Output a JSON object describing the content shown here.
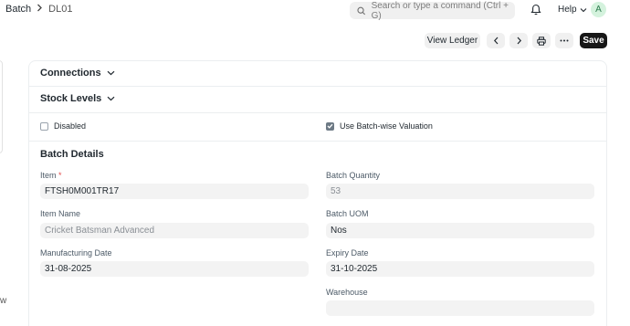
{
  "breadcrumb": {
    "root": "Batch",
    "current": "DL01"
  },
  "search": {
    "placeholder": "Search or type a command (Ctrl + G)"
  },
  "header": {
    "help_label": "Help",
    "avatar_initial": "A"
  },
  "toolbar": {
    "view_ledger_label": "View Ledger",
    "save_label": "Save"
  },
  "left_partial_text": "w",
  "sections": {
    "connections": "Connections",
    "stock_levels": "Stock Levels",
    "batch_details": "Batch Details"
  },
  "checkboxes": {
    "disabled": {
      "label": "Disabled",
      "checked": false
    },
    "batch_wise_valuation": {
      "label": "Use Batch-wise Valuation",
      "checked": true
    }
  },
  "fields": {
    "item": {
      "label": "Item",
      "required_mark": "*",
      "value": "FTSH0M001TR17"
    },
    "item_name": {
      "label": "Item Name",
      "value": "Cricket Batsman Advanced"
    },
    "manufacturing_date": {
      "label": "Manufacturing Date",
      "value": "31-08-2025"
    },
    "batch_quantity": {
      "label": "Batch Quantity",
      "value": "53"
    },
    "batch_uom": {
      "label": "Batch UOM",
      "value": "Nos"
    },
    "expiry_date": {
      "label": "Expiry Date",
      "value": "31-10-2025"
    },
    "warehouse": {
      "label": "Warehouse",
      "value": ""
    }
  }
}
